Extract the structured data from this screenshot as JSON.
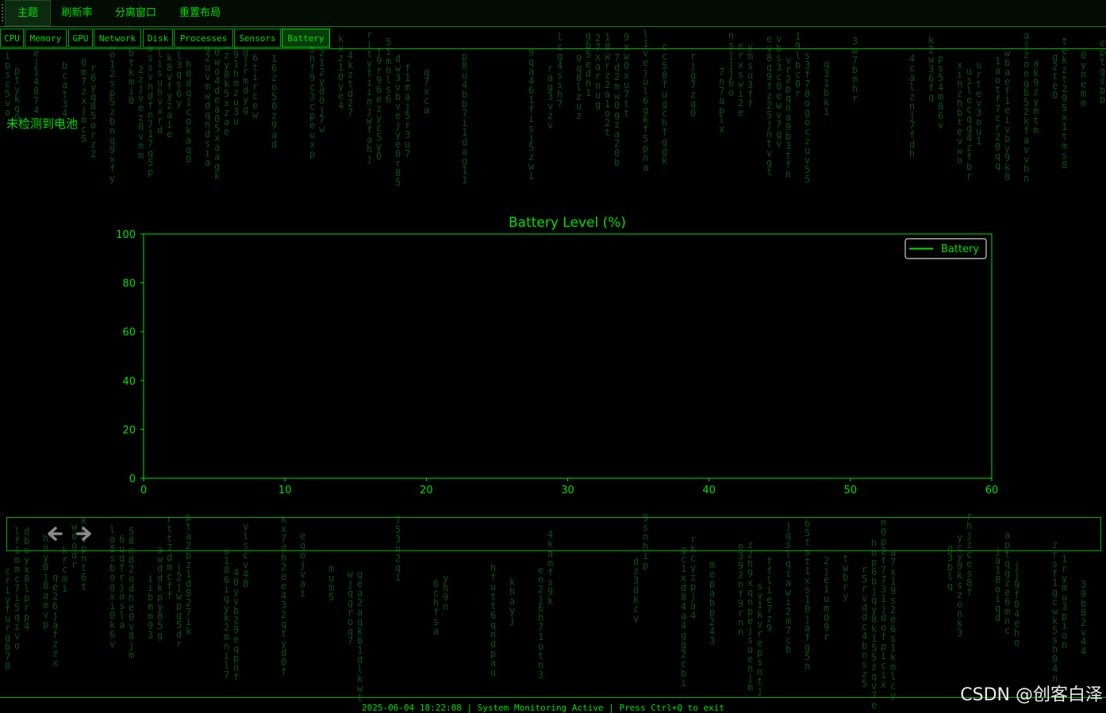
{
  "menu": [
    "主题",
    "刷新率",
    "分离窗口",
    "重置布局"
  ],
  "tabs": [
    "CPU",
    "Memory",
    "GPU",
    "Network",
    "Disk",
    "Processes",
    "Sensors",
    "Battery"
  ],
  "active_tab": "Battery",
  "message": "未检测到电池",
  "chart_data": {
    "type": "line",
    "title": "Battery Level (%)",
    "series": [
      {
        "name": "Battery",
        "x": [],
        "values": []
      }
    ],
    "xlim": [
      0,
      60
    ],
    "ylim": [
      0,
      100
    ],
    "xticks": [
      "0",
      "10",
      "20",
      "30",
      "40",
      "50",
      "60"
    ],
    "yticks": [
      "0",
      "20",
      "40",
      "60",
      "80",
      "100"
    ],
    "legend": "upper-right",
    "grid": false,
    "color": "#00e000"
  },
  "toolbar": {
    "back_icon": "arrow-left-icon",
    "forward_icon": "arrow-right-icon"
  },
  "status": "2025-06-04 18:22:08 | System Monitoring Active | Press Ctrl+Q to exit",
  "watermark": "CSDN @创客白泽"
}
